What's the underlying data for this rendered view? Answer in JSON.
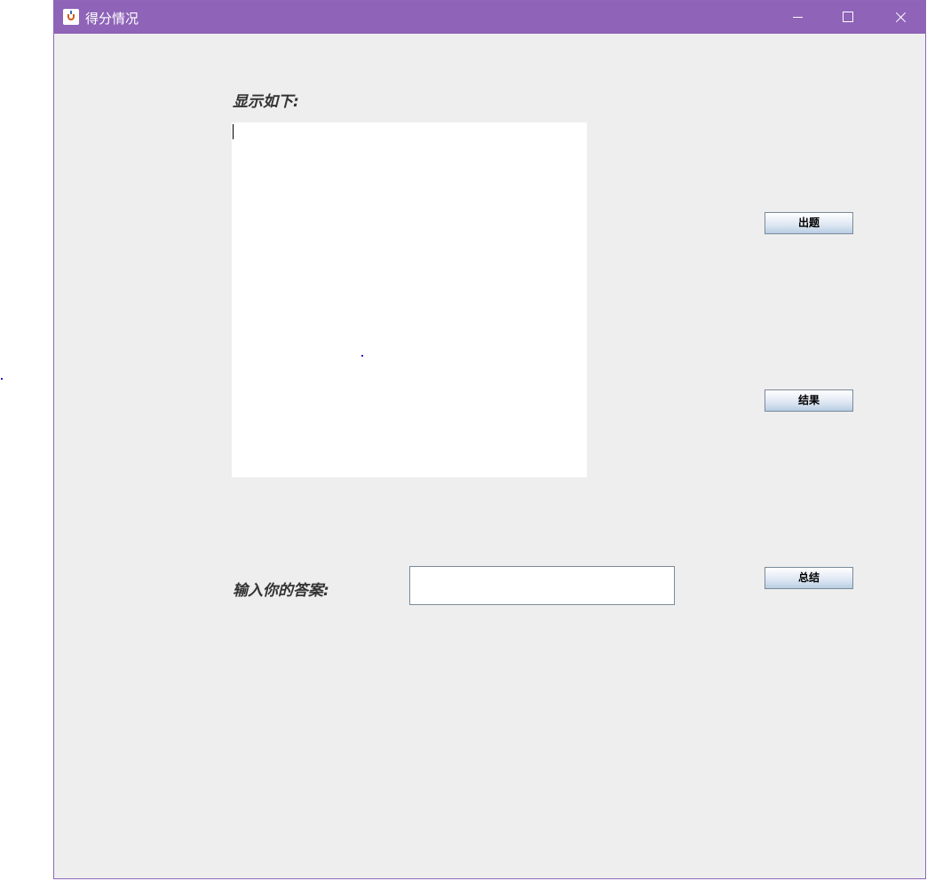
{
  "window": {
    "title": "得分情况"
  },
  "main": {
    "display_label": "显示如下:",
    "display_text": "",
    "answer_label": "输入你的答案:",
    "answer_value": ""
  },
  "buttons": {
    "question": "出题",
    "result": "结果",
    "summary": "总结"
  },
  "colors": {
    "titlebar": "#8e63b8",
    "window_bg": "#eeeeee",
    "label_text": "#333333"
  }
}
